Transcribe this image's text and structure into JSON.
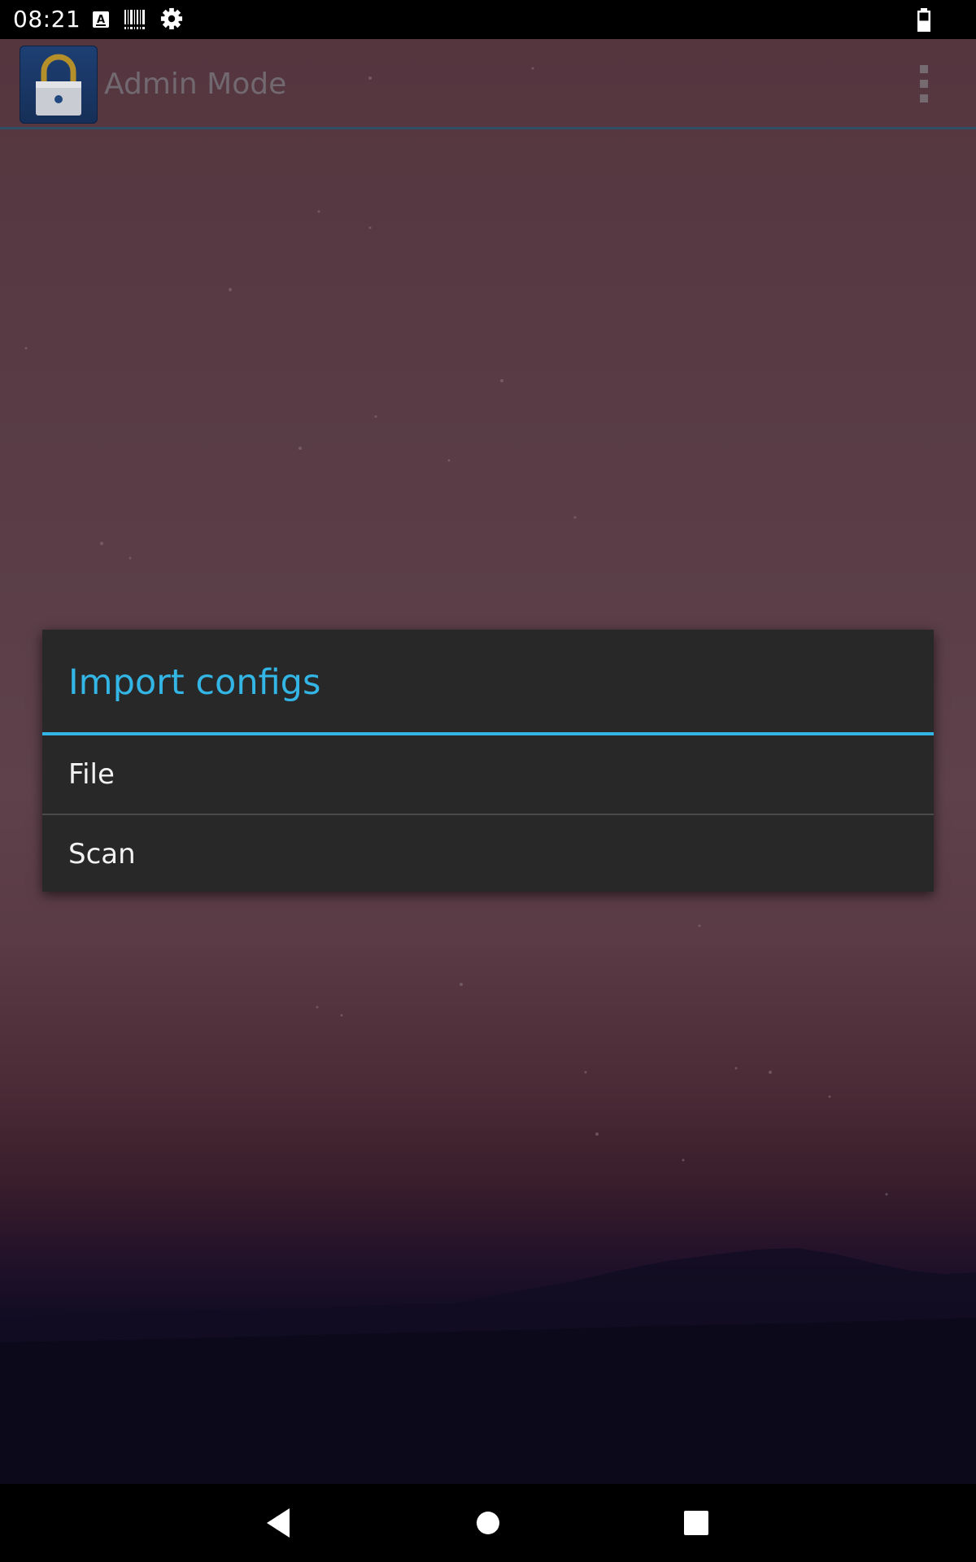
{
  "status_bar": {
    "time": "08:21",
    "icons": [
      "keyboard-icon",
      "barcode-icon",
      "settings-icon",
      "battery-icon"
    ]
  },
  "action_bar": {
    "title": "Admin Mode",
    "app_icon": "lock-icon",
    "menu_icon": "overflow-menu-icon"
  },
  "dialog": {
    "title": "Import configs",
    "items": [
      {
        "label": "File"
      },
      {
        "label": "Scan"
      }
    ]
  },
  "nav_bar": {
    "buttons": [
      "back-icon",
      "home-icon",
      "recents-icon"
    ]
  },
  "colors": {
    "accent": "#33b5e5",
    "dialog_background": "#282828",
    "status_bar": "#000000"
  }
}
